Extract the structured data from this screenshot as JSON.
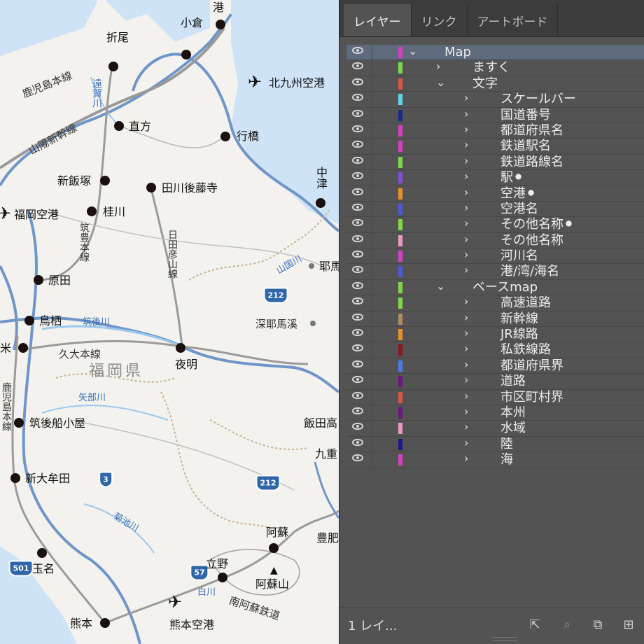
{
  "map": {
    "labels": {
      "port": "港",
      "kokura": "小倉",
      "orio": "折尾",
      "kitakyushu_airport": "北九州空港",
      "kagoshima_line": "鹿児島本線",
      "onga_river": "遠賀川",
      "nogata": "直方",
      "sanyo_shinkansen": "山陽新幹線",
      "yukuhashi": "行橋",
      "nakatsu": "中津",
      "shiniizuka": "新飯塚",
      "tagawagotoji": "田川後藤寺",
      "fukuoka_airport": "福岡空港",
      "keisen": "桂川",
      "chikuho_line": "筑豊本線",
      "hitahikosan_line": "日田彦山線",
      "yamakuni_river": "山国川",
      "yaba": "耶馬",
      "harada": "原田",
      "route212a": "212",
      "tosu": "鳥栖",
      "chikugo_river": "筑後川",
      "shinyabakei": "深耶馬溪",
      "kurume": "米",
      "kyudai_line": "久大本線",
      "yoake": "夜明",
      "fukuoka_pref": "福岡県",
      "kagoshima_line_v": "鹿児島本線",
      "yabe_river": "矢部川",
      "chikugo_funagoya": "筑後船小屋",
      "iidakogen": "飯田高",
      "kokonoe": "九重",
      "shinomuta": "新大牟田",
      "route3": "3",
      "route212b": "212",
      "kikuchi_river": "菊池川",
      "aso": "阿蘇",
      "bungo": "豊肥",
      "tamana": "玉名",
      "route501": "501",
      "tateno": "立野",
      "route57": "57",
      "shirakawa": "白川",
      "asosan": "阿蘇山",
      "minamiaso_railway": "南阿蘇鉄道",
      "kumamoto": "熊本",
      "kumamoto_airport": "熊本空港"
    }
  },
  "panel": {
    "tabs": [
      "レイヤー",
      "リンク",
      "アートボード"
    ],
    "layers": [
      {
        "name": "Map",
        "color": "#d63fc4",
        "level": 0,
        "expanded": true,
        "selected": true
      },
      {
        "name": "ますく",
        "color": "#7fd64a",
        "level": 1,
        "expanded": false
      },
      {
        "name": "文字",
        "color": "#d8544a",
        "level": 1,
        "expanded": true
      },
      {
        "name": "スケールバー",
        "color": "#5ad8e8",
        "level": 2,
        "expanded": false
      },
      {
        "name": "国道番号",
        "color": "#1a2a8a",
        "level": 2,
        "expanded": false
      },
      {
        "name": "都道府県名",
        "color": "#d63fc4",
        "level": 2,
        "expanded": false
      },
      {
        "name": "鉄道駅名",
        "color": "#d63fc4",
        "level": 2,
        "expanded": false
      },
      {
        "name": "鉄道路線名",
        "color": "#7fd64a",
        "level": 2,
        "expanded": false
      },
      {
        "name": "駅⚫",
        "color": "#8a4ad8",
        "level": 2,
        "expanded": false
      },
      {
        "name": "空港⚫",
        "color": "#e8902a",
        "level": 2,
        "expanded": false
      },
      {
        "name": "空港名",
        "color": "#4a5ad8",
        "level": 2,
        "expanded": false
      },
      {
        "name": "その他名称⚫",
        "color": "#7fd64a",
        "level": 2,
        "expanded": false
      },
      {
        "name": "その他名称",
        "color": "#e89ac4",
        "level": 2,
        "expanded": false
      },
      {
        "name": "河川名",
        "color": "#d63fc4",
        "level": 2,
        "expanded": false
      },
      {
        "name": "港/湾/海名",
        "color": "#4a5ad8",
        "level": 2,
        "expanded": false
      },
      {
        "name": "ベースmap",
        "color": "#7fd64a",
        "level": 1,
        "expanded": true
      },
      {
        "name": "高速道路",
        "color": "#7fd64a",
        "level": 2,
        "expanded": false
      },
      {
        "name": "新幹線",
        "color": "#b08a5a",
        "level": 2,
        "expanded": false
      },
      {
        "name": "JR線路",
        "color": "#e8902a",
        "level": 2,
        "expanded": false
      },
      {
        "name": "私鉄線路",
        "color": "#8a1a1a",
        "level": 2,
        "expanded": false
      },
      {
        "name": "都道府県界",
        "color": "#4a7ae8",
        "level": 2,
        "expanded": false
      },
      {
        "name": "道路",
        "color": "#6a1a7a",
        "level": 2,
        "expanded": false
      },
      {
        "name": "市区町村界",
        "color": "#d8544a",
        "level": 2,
        "expanded": false
      },
      {
        "name": "本州",
        "color": "#6a1a7a",
        "level": 2,
        "expanded": false
      },
      {
        "name": "水域",
        "color": "#e89ac4",
        "level": 2,
        "expanded": false
      },
      {
        "name": "陸",
        "color": "#1a1a8a",
        "level": 2,
        "expanded": false
      },
      {
        "name": "海",
        "color": "#d63fc4",
        "level": 2,
        "expanded": false
      }
    ],
    "footer": {
      "count": "1 レイ..."
    }
  }
}
